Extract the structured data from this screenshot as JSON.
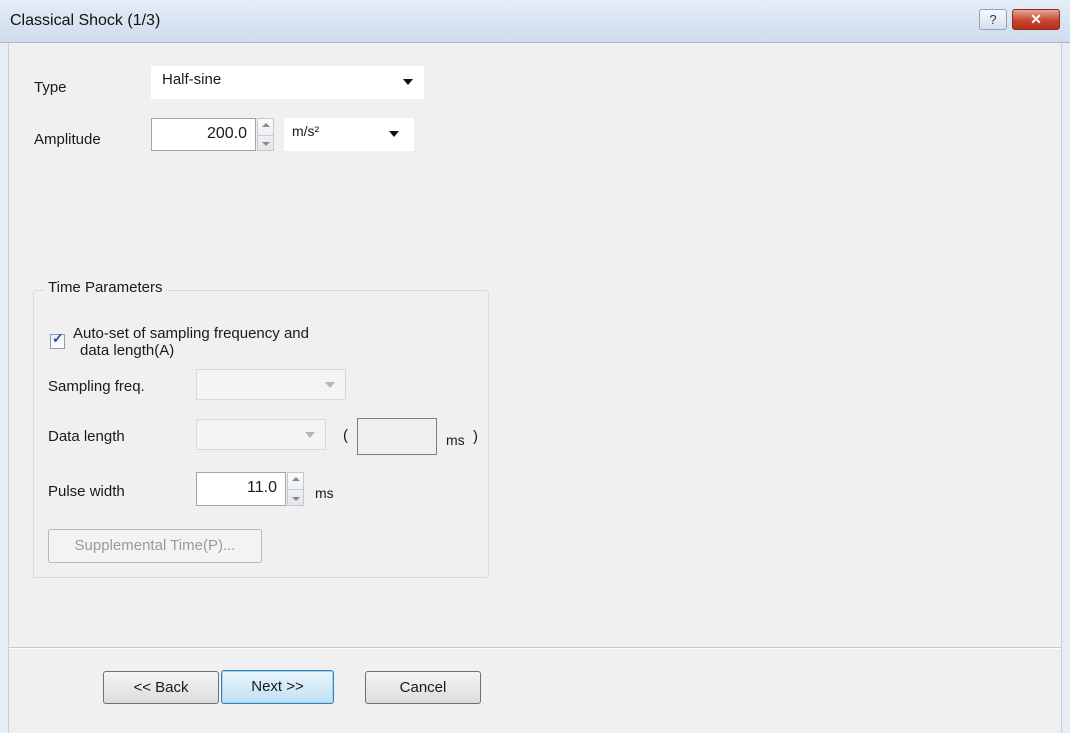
{
  "window": {
    "title": "Classical Shock (1/3)",
    "help_glyph": "?",
    "close_glyph": "✕"
  },
  "type": {
    "label": "Type",
    "value": "Half-sine"
  },
  "amplitude": {
    "label": "Amplitude",
    "value": "200.0",
    "unit": "m/s²"
  },
  "time_params": {
    "title": "Time Parameters",
    "auto_set": {
      "label_line1": "Auto-set of sampling frequency and",
      "label_line2": "data length(A)",
      "checked": true
    },
    "sampling_freq": {
      "label": "Sampling freq.",
      "value": ""
    },
    "data_length": {
      "label": "Data length",
      "value": "",
      "open_paren": "(",
      "ms_value": "",
      "unit": "ms",
      "close_paren": ")"
    },
    "pulse_width": {
      "label": "Pulse width",
      "value": "11.0",
      "unit": "ms"
    },
    "supplemental_button": "Supplemental Time(P)..."
  },
  "buttons": {
    "back": "<< Back",
    "next": "Next >>",
    "cancel": "Cancel"
  },
  "colors": {
    "title_bar": "#d6e2f0",
    "close_button": "#c9452f",
    "default_button": "#bfe0f5"
  }
}
